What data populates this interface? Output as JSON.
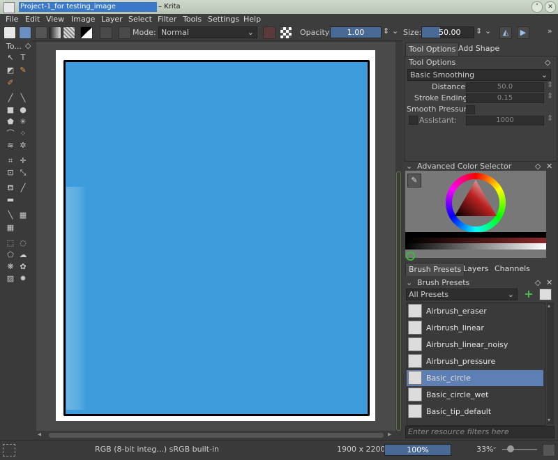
{
  "window": {
    "title_selected": "Project-1_for testing_image",
    "title_suffix": "– Krita"
  },
  "menubar": [
    "File",
    "Edit",
    "View",
    "Image",
    "Layer",
    "Select",
    "Filter",
    "Tools",
    "Settings",
    "Help"
  ],
  "toolbar": {
    "mode_label": "Mode:",
    "mode_value": "Normal",
    "opacity_label": "Opacity:",
    "opacity_value": "1.00",
    "size_label": "Size:",
    "size_value": "50.00"
  },
  "toolbox": {
    "title": "To..."
  },
  "tool_options": {
    "tabs": [
      "Tool Options",
      "Add Shape"
    ],
    "panel_title": "Tool Options",
    "smoothing": "Basic Smoothing",
    "distance_label": "Distance:",
    "distance_value": "50.0",
    "stroke_ending_label": "Stroke Ending:",
    "stroke_ending_value": "0.15",
    "smooth_pressure_label": "Smooth Pressure",
    "assistant_label": "Assistant:",
    "assistant_value": "1000"
  },
  "color_selector": {
    "title": "Advanced Color Selector"
  },
  "brush_tabs": [
    "Brush Presets",
    "Layers",
    "Channels"
  ],
  "brush_presets": {
    "title": "Brush Presets",
    "filter": "All Presets",
    "items": [
      "Airbrush_eraser",
      "Airbrush_linear",
      "Airbrush_linear_noisy",
      "Airbrush_pressure",
      "Basic_circle",
      "Basic_circle_wet",
      "Basic_tip_default"
    ],
    "selected_index": 4,
    "search_placeholder": "Enter resource filters here"
  },
  "status": {
    "color_model": "RGB (8-bit integ...)  sRGB built-in",
    "dimensions": "1900 x 2200",
    "progress": "100%",
    "zoom": "33%"
  },
  "colors": {
    "canvas_fill": "#3e9cdc",
    "selection": "#5d7fb3",
    "title_highlight": "#3a78c9"
  }
}
